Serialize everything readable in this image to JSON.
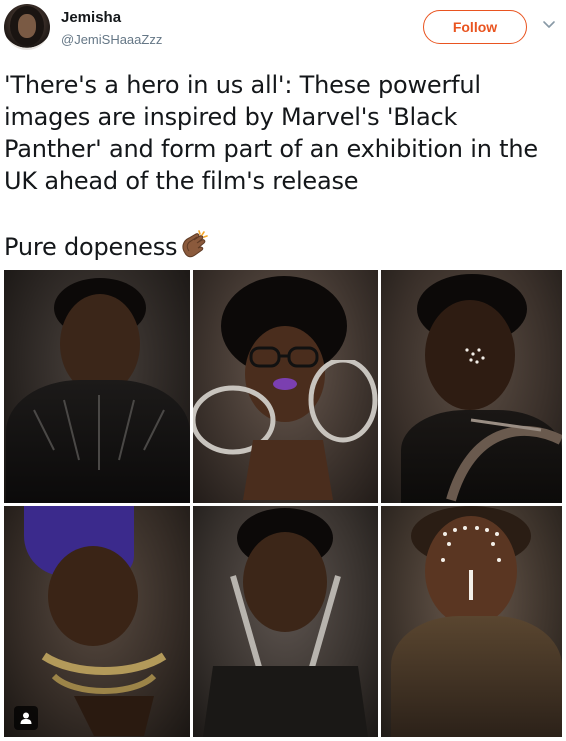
{
  "tweet": {
    "author_name": "Jemisha",
    "author_handle": "@JemiSHaaaZzz",
    "follow_label": "Follow",
    "text": "'There's a hero in us all': These powerful images are inspired by Marvel's 'Black Panther' and form part of an exhibition in the UK ahead of the film's release\n\nPure dopeness",
    "emoji": "clapping-hands-icon"
  },
  "media": {
    "photos": [
      {
        "subject": "boy-in-black-panther-suit"
      },
      {
        "subject": "girl-with-glasses-and-rings"
      },
      {
        "subject": "boy-with-face-paint-and-bow"
      },
      {
        "subject": "girl-with-tall-purple-headdress"
      },
      {
        "subject": "boy-with-crossed-blades"
      },
      {
        "subject": "girl-with-white-face-dots"
      }
    ],
    "badge_icon": "person-tag-icon"
  },
  "colors": {
    "follow_accent": "#e95420",
    "handle_gray": "#657786",
    "text": "#14171a"
  }
}
